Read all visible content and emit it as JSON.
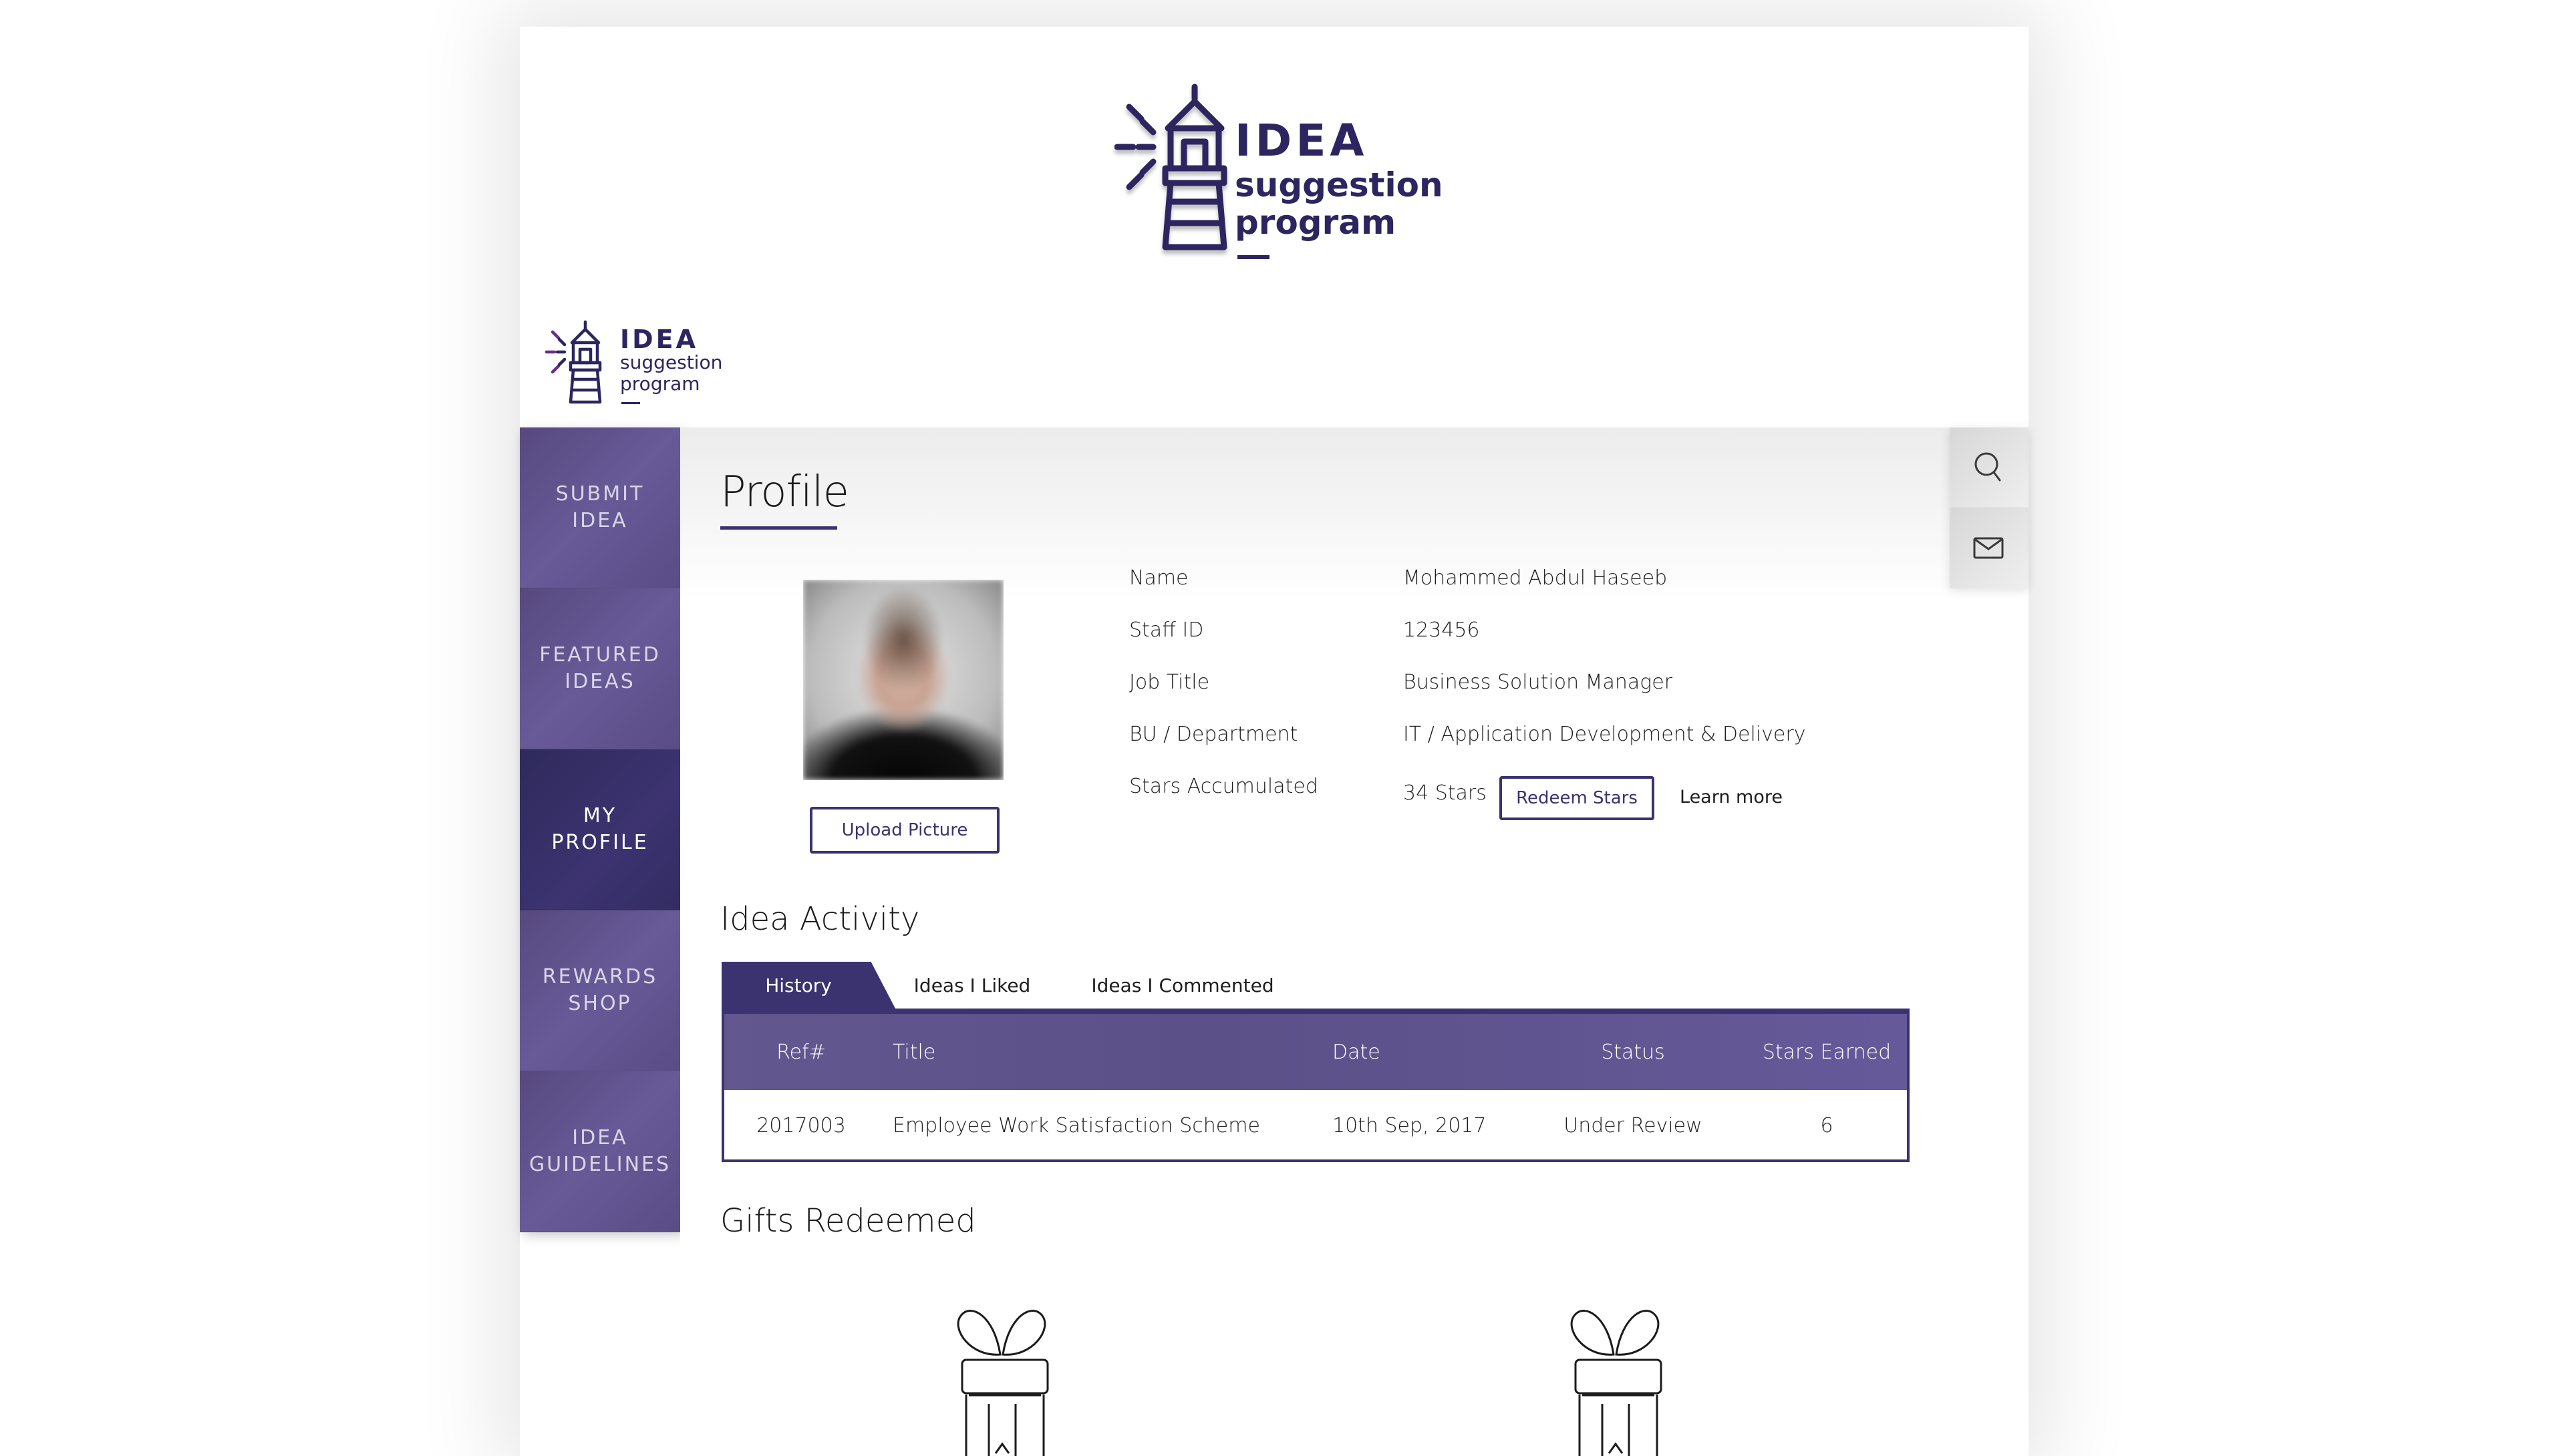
{
  "brand": {
    "line1": "IDEA",
    "line2": "suggestion",
    "line3": "program",
    "primary_color": "#3a3370",
    "nav_color": "#63578f",
    "nav_active_color": "#332c62"
  },
  "sidebar": {
    "items": [
      {
        "label": "SUBMIT\nIDEA",
        "active": false
      },
      {
        "label": "FEATURED\nIDEAS",
        "active": false
      },
      {
        "label": "MY\nPROFILE",
        "active": true
      },
      {
        "label": "REWARDS\nSHOP",
        "active": false
      },
      {
        "label": "IDEA\nGUIDELINES",
        "active": false
      }
    ]
  },
  "utility": {
    "icons": [
      "search-icon",
      "mail-icon"
    ]
  },
  "profile": {
    "title": "Profile",
    "upload_label": "Upload Picture",
    "fields": [
      {
        "label": "Name",
        "value": "Mohammed Abdul Haseeb"
      },
      {
        "label": "Staff ID",
        "value": "123456"
      },
      {
        "label": "Job Title",
        "value": "Business Solution Manager"
      },
      {
        "label": "BU / Department",
        "value": "IT / Application Development & Delivery"
      },
      {
        "label": "Stars Accumulated",
        "value": "34 Stars"
      }
    ],
    "redeem_label": "Redeem Stars",
    "learn_more_label": "Learn more"
  },
  "activity": {
    "title": "Idea Activity",
    "tabs": [
      {
        "label": "History",
        "active": true
      },
      {
        "label": "Ideas I Liked",
        "active": false
      },
      {
        "label": "Ideas I Commented",
        "active": false
      }
    ],
    "columns": [
      "Ref#",
      "Title",
      "Date",
      "Status",
      "Stars Earned"
    ],
    "rows": [
      {
        "ref": "2017003",
        "title": "Employee Work Satisfaction Scheme",
        "date": "10th Sep, 2017",
        "status": "Under Review",
        "stars": "6"
      }
    ]
  },
  "gifts": {
    "title": "Gifts Redeemed",
    "items": [
      "gift-icon",
      "gift-icon"
    ]
  }
}
